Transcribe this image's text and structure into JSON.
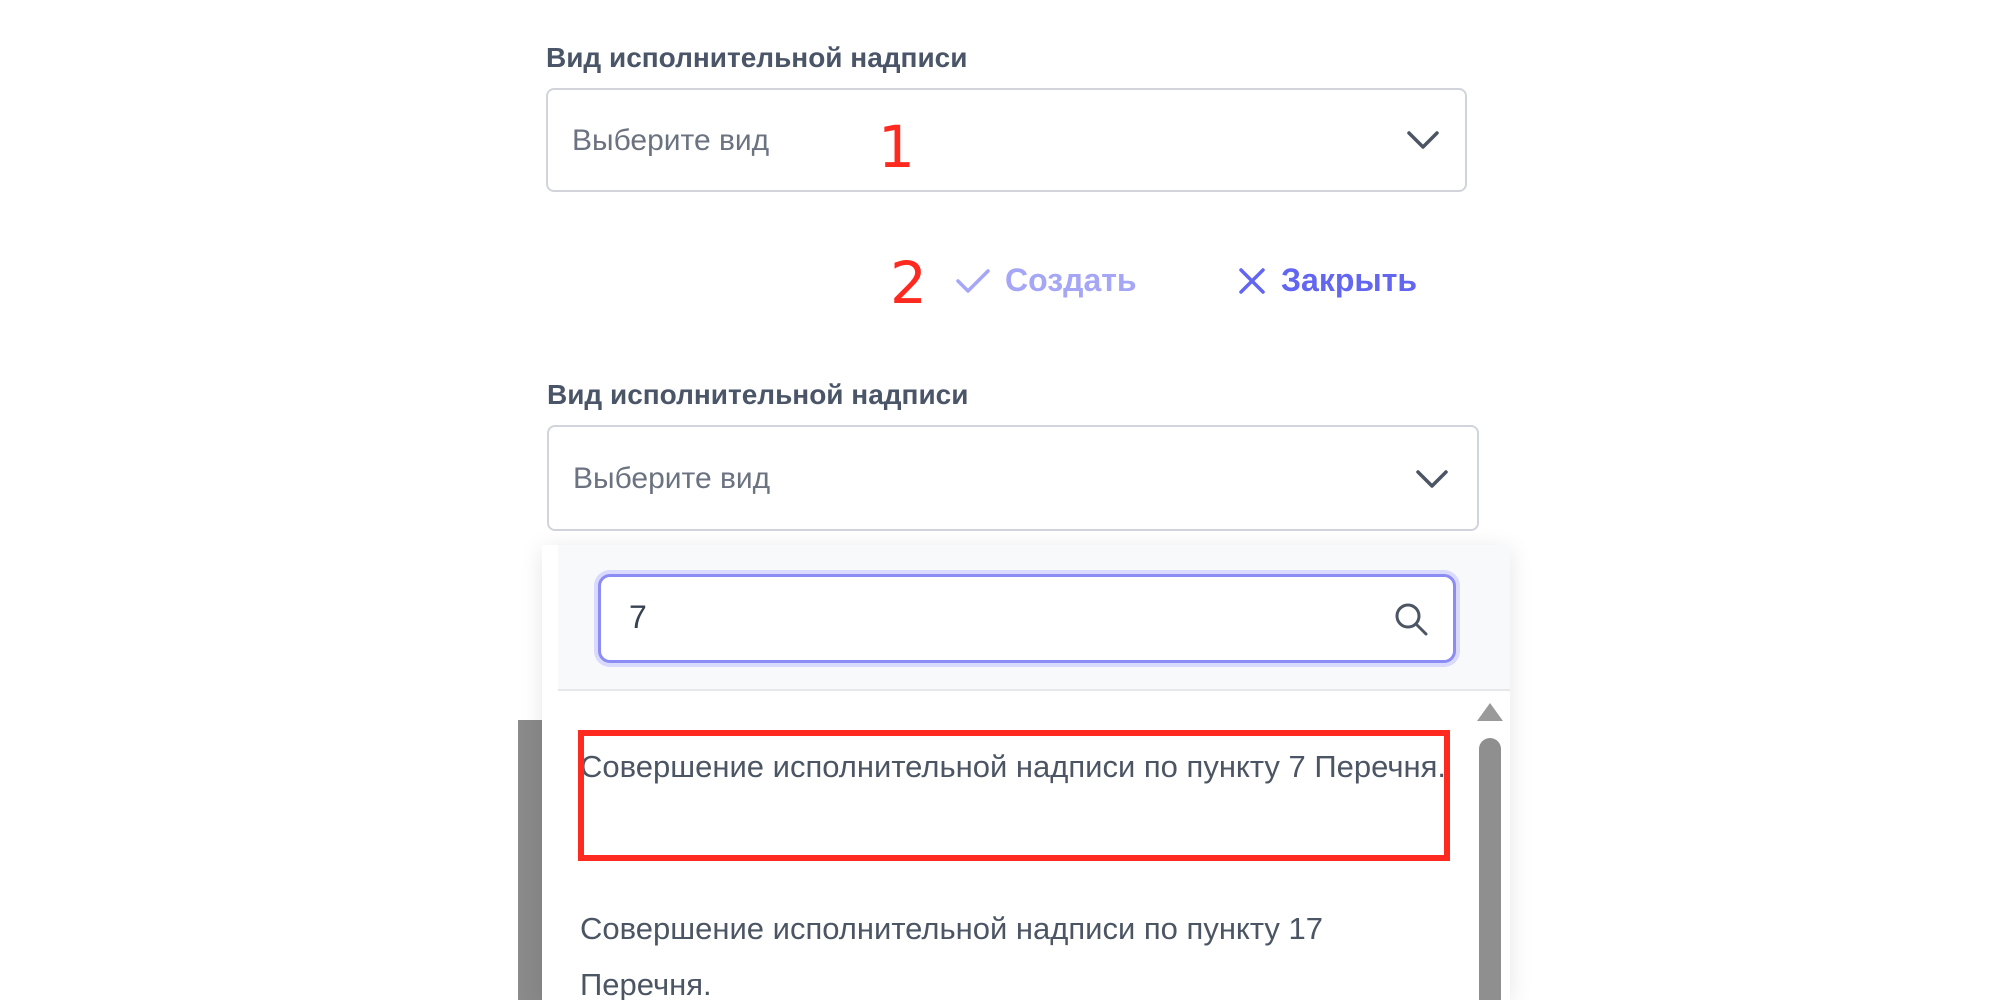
{
  "form_top": {
    "label": "Вид исполнительной надписи",
    "select_placeholder": "Выберите вид",
    "annotation_marker": "1"
  },
  "actions": {
    "annotation_marker": "2",
    "create_label": "Создать",
    "close_label": "Закрыть"
  },
  "form_bottom": {
    "label": "Вид исполнительной надписи",
    "select_placeholder": "Выберите вид",
    "search_value": "7",
    "options": [
      {
        "text": "Совершение исполнительной надписи по пункту 7 Перечня.",
        "highlighted": true
      },
      {
        "text": "Совершение исполнительной надписи по пункту 17 Перечня.",
        "highlighted": false
      }
    ]
  },
  "colors": {
    "annotation_red": "#ff2a1f",
    "accent_primary": "#6366f1",
    "accent_disabled": "#a5a6f6",
    "search_focus_border": "#8b8cf4"
  },
  "icons": {
    "chevron": "chevron-down-icon",
    "create": "check-icon",
    "close": "close-icon",
    "search": "search-icon"
  }
}
